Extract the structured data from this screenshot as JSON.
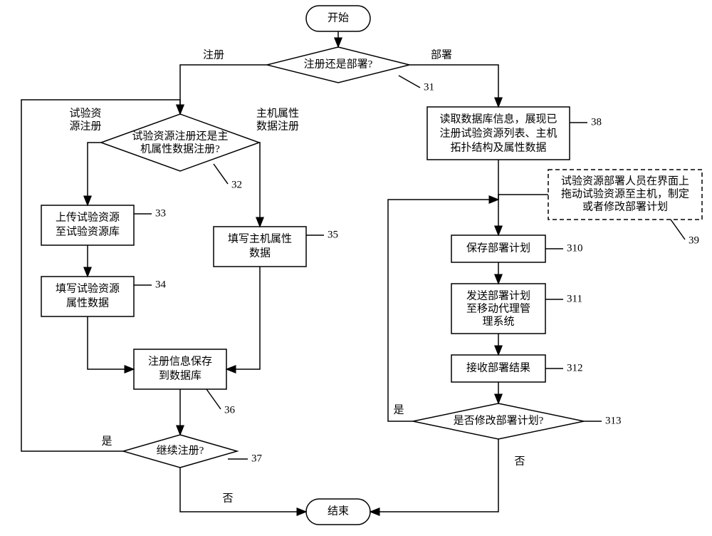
{
  "chart_data": {
    "type": "flowchart",
    "title": "",
    "nodes": {
      "start": {
        "kind": "terminal",
        "label": "开始"
      },
      "d31": {
        "kind": "decision",
        "label": "注册还是部署?",
        "id": "31"
      },
      "d32": {
        "kind": "decision",
        "label": "试验资源注册还是主\n机属性数据注册?",
        "id": "32"
      },
      "p33": {
        "kind": "process",
        "label": "上传试验资源\n至试验资源库",
        "id": "33"
      },
      "p34": {
        "kind": "process",
        "label": "填写试验资源\n属性数据",
        "id": "34"
      },
      "p35": {
        "kind": "process",
        "label": "填写主机属性\n数据",
        "id": "35"
      },
      "p36": {
        "kind": "process",
        "label": "注册信息保存\n到数据库",
        "id": "36"
      },
      "d37": {
        "kind": "decision",
        "label": "继续注册?",
        "id": "37"
      },
      "p38": {
        "kind": "process",
        "label": "读取数据库信息，展现已\n注册试验资源列表、主机\n拓扑结构及属性数据",
        "id": "38"
      },
      "n39": {
        "kind": "note",
        "label": "试验资源部署人员在界面上\n拖动试验资源至主机，制定\n或者修改部署计划",
        "id": "39"
      },
      "p310": {
        "kind": "process",
        "label": "保存部署计划",
        "id": "310"
      },
      "p311": {
        "kind": "process",
        "label": "发送部署计划\n至移动代理管\n理系统",
        "id": "311"
      },
      "p312": {
        "kind": "process",
        "label": "接收部署结果",
        "id": "312"
      },
      "d313": {
        "kind": "decision",
        "label": "是否修改部署计划?",
        "id": "313"
      },
      "end": {
        "kind": "terminal",
        "label": "结束"
      }
    },
    "edge_labels": {
      "e_31_left": "注册",
      "e_31_right": "部署",
      "e_32_left": "试验资\n源注册",
      "e_32_right": "主机属性\n数据注册",
      "e_37_yes": "是",
      "e_37_no": "否",
      "e_313_yes": "是",
      "e_313_no": "否"
    },
    "edges": [
      {
        "from": "start",
        "to": "d31"
      },
      {
        "from": "d31",
        "to": "d32",
        "label_key": "e_31_left"
      },
      {
        "from": "d31",
        "to": "p38",
        "label_key": "e_31_right"
      },
      {
        "from": "d32",
        "to": "p33",
        "label_key": "e_32_left"
      },
      {
        "from": "d32",
        "to": "p35",
        "label_key": "e_32_right"
      },
      {
        "from": "p33",
        "to": "p34"
      },
      {
        "from": "p34",
        "to": "p36"
      },
      {
        "from": "p35",
        "to": "p36"
      },
      {
        "from": "p36",
        "to": "d37"
      },
      {
        "from": "d37",
        "to": "d32",
        "label_key": "e_37_yes"
      },
      {
        "from": "d37",
        "to": "end",
        "label_key": "e_37_no"
      },
      {
        "from": "p38",
        "to": "p310",
        "via": "n39"
      },
      {
        "from": "p310",
        "to": "p311"
      },
      {
        "from": "p311",
        "to": "p312"
      },
      {
        "from": "p312",
        "to": "d313"
      },
      {
        "from": "d313",
        "to": "p310",
        "label_key": "e_313_yes"
      },
      {
        "from": "d313",
        "to": "end",
        "label_key": "e_313_no"
      }
    ]
  }
}
